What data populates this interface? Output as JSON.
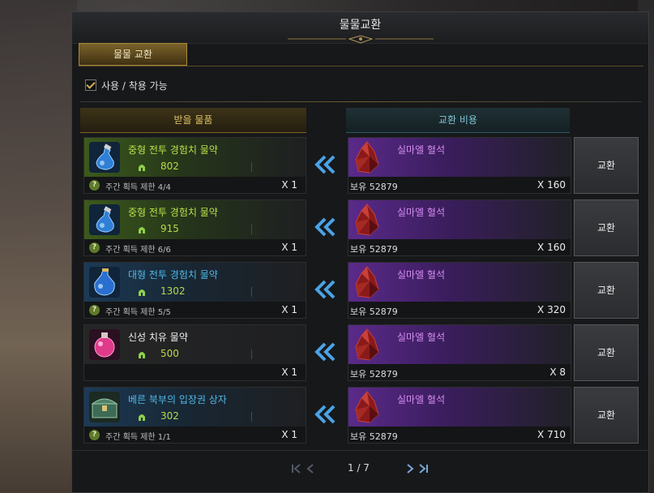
{
  "window": {
    "title": "물물교환"
  },
  "tab": {
    "label": "물물 교환"
  },
  "filter": {
    "label": "사용 / 착용 가능",
    "checked": true
  },
  "headers": {
    "receive": "받을 물품",
    "cost": "교환 비용"
  },
  "rows": [
    {
      "name": "중형 전투 경험치 물약",
      "name_color": "#b8e04a",
      "points": "802",
      "limit": "주간 획득 제한 4/4",
      "qty": "X 1",
      "cost_name": "실마엘 혈석",
      "owned": "보유 52879",
      "cost_qty": "X 160",
      "button": "교환",
      "icon": "potion-blue-icon"
    },
    {
      "name": "중형 전투 경험치 물약",
      "name_color": "#b8e04a",
      "points": "915",
      "limit": "주간 획득 제한 6/6",
      "qty": "X 1",
      "cost_name": "실마엘 혈석",
      "owned": "보유 52879",
      "cost_qty": "X 160",
      "button": "교환",
      "icon": "potion-blue-icon"
    },
    {
      "name": "대형 전투 경험치 물약",
      "name_color": "#4fb8e8",
      "points": "1302",
      "limit": "주간 획득 제한 5/5",
      "qty": "X 1",
      "cost_name": "실마엘 혈석",
      "owned": "보유 52879",
      "cost_qty": "X 320",
      "button": "교환",
      "icon": "potion-large-blue-icon"
    },
    {
      "name": "신성 치유 물약",
      "name_color": "#f0f0f0",
      "points": "500",
      "limit": "",
      "qty": "X 1",
      "cost_name": "실마엘 혈석",
      "owned": "보유 52879",
      "cost_qty": "X 8",
      "button": "교환",
      "icon": "potion-pink-icon"
    },
    {
      "name": "베른 북부의 입장권 상자",
      "name_color": "#4fb8e8",
      "points": "302",
      "limit": "주간 획득 제한 1/1",
      "qty": "X 1",
      "cost_name": "실마엘 혈석",
      "owned": "보유 52879",
      "cost_qty": "X 710",
      "button": "교환",
      "icon": "chest-icon"
    }
  ],
  "pager": {
    "text": "1 / 7"
  }
}
